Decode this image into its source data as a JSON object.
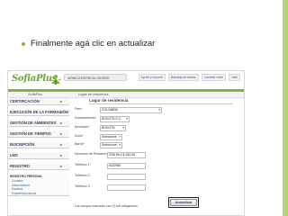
{
  "slide": {
    "bullet_text": "Finalmente agá clic en actualizar",
    "accent_color": "#b8d07a"
  },
  "app": {
    "logo_text": "SofiaPlus",
    "logo_sup": "+",
    "user_name": "MÓNICA PATRICIA OSORIO",
    "top_links": [
      "Ayuda y soporte",
      "Bandeja de tareas",
      "Cambiar clave",
      "Salir"
    ],
    "subbar_left": "SofiaPlus",
    "subbar_section": "Lugar de residencia",
    "brand_green": "#7db63c"
  },
  "sidebar": {
    "items": [
      {
        "label": "CERTIFICACIÓN"
      },
      {
        "label": "EJECUCIÓN DE LA FORMACIÓN"
      },
      {
        "label": "GESTIÓN DE AMBIENTES"
      },
      {
        "label": "GESTIÓN DE TIEMPOS"
      },
      {
        "label": "INSCRIPCIÓN"
      },
      {
        "label": "LMS"
      },
      {
        "label": "REGISTRO"
      }
    ],
    "arrow_glyph": "▸",
    "submenu_title": "REGISTRO PERSONA",
    "submenu_links": [
      "Contacto",
      "Datos básicos",
      "Estudios",
      "Experiencia laboral"
    ]
  },
  "form": {
    "title": "Lugar de residencia",
    "fields": [
      {
        "label": "País",
        "value": "COLOMBIA",
        "type": "select"
      },
      {
        "label": "Departamento",
        "value": "BOGOTÁ D.C.",
        "type": "select"
      },
      {
        "label": "Municipio",
        "value": "BOGOTÁ",
        "type": "select"
      },
      {
        "label": "Zona",
        "value": "Seleccione",
        "type": "select"
      },
      {
        "label": "Barrio",
        "value": "Seleccione",
        "type": "select"
      },
      {
        "label": "Dirección de Residencia",
        "value": "CRA 96 # 8-184 56",
        "type": "text"
      },
      {
        "label": "Teléfono 1",
        "value": "6422985",
        "type": "text"
      },
      {
        "label": "Teléfono 2",
        "value": "",
        "type": "text"
      },
      {
        "label": "Teléfono 3",
        "value": "",
        "type": "text"
      }
    ],
    "required_mark": "*",
    "note": "Los campos marcados con (*) son obligatorios",
    "update_button_label": "Actualizar"
  }
}
